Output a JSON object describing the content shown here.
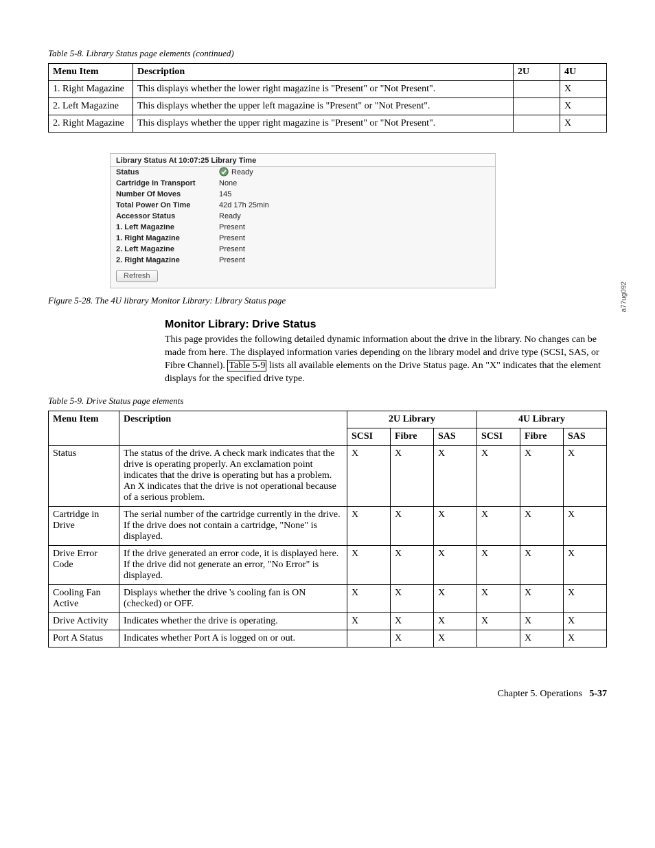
{
  "caption1": "Table 5-8. Library Status page elements  (continued)",
  "table1": {
    "headers": [
      "Menu Item",
      "Description",
      "2U",
      "4U"
    ],
    "rows": [
      {
        "menu": "1. Right Magazine",
        "desc": "This displays whether the lower right magazine is \"Present\" or \"Not Present\".",
        "c2u": "",
        "c4u": "X"
      },
      {
        "menu": "2. Left Magazine",
        "desc": "This displays whether the upper left magazine is \"Present\" or \"Not Present\".",
        "c2u": "",
        "c4u": "X"
      },
      {
        "menu": "2. Right Magazine",
        "desc": "This displays whether the upper right magazine is \"Present\" or \"Not Present\".",
        "c2u": "",
        "c4u": "X"
      }
    ]
  },
  "shot": {
    "title": "Library Status At 10:07:25 Library Time",
    "rows": [
      {
        "label": "Status",
        "value": "Ready",
        "icon": true
      },
      {
        "label": "Cartridge In Transport",
        "value": "None"
      },
      {
        "label": "Number Of Moves",
        "value": "145"
      },
      {
        "label": "Total Power On Time",
        "value": "42d 17h 25min"
      },
      {
        "label": "Accessor Status",
        "value": "Ready"
      },
      {
        "label": "1. Left Magazine",
        "value": "Present"
      },
      {
        "label": "1. Right Magazine",
        "value": "Present"
      },
      {
        "label": "2. Left Magazine",
        "value": "Present"
      },
      {
        "label": "2. Right Magazine",
        "value": "Present"
      }
    ],
    "button": "Refresh",
    "sidecode": "a77ug092"
  },
  "figcaption": "Figure 5-28. The 4U library Monitor Library: Library Status page",
  "heading": "Monitor Library: Drive Status",
  "paragraph_parts": {
    "p1": "This page provides the following detailed dynamic information about the drive in the library. No changes can be made from here. The displayed information varies depending on the library model and drive type (SCSI, SAS, or Fibre Channel). ",
    "link": "Table 5-9",
    "p2": " lists all available elements on the Drive Status page. An \"X\" indicates that the element displays for the specified drive type."
  },
  "caption2": "Table 5-9. Drive Status page elements",
  "table2": {
    "top_headers": {
      "menu": "Menu Item",
      "desc": "Description",
      "lib2u": "2U Library",
      "lib4u": "4U Library"
    },
    "sub_headers": [
      "SCSI",
      "Fibre",
      "SAS",
      "SCSI",
      "Fibre",
      "SAS"
    ],
    "rows": [
      {
        "menu": "Status",
        "desc": "The status of the drive. A check mark indicates that the drive is operating properly. An exclamation point indicates that the drive is operating but has a problem. An X indicates that the drive is not operational because of a serious problem.",
        "v": [
          "X",
          "X",
          "X",
          "X",
          "X",
          "X"
        ]
      },
      {
        "menu": "Cartridge in Drive",
        "desc": "The serial number of the cartridge currently in the drive. If the drive does not contain a cartridge, \"None\" is displayed.",
        "v": [
          "X",
          "X",
          "X",
          "X",
          "X",
          "X"
        ]
      },
      {
        "menu": "Drive Error Code",
        "desc": "If the drive generated an error code, it is displayed here. If the drive did not generate an error, \"No Error\" is displayed.",
        "v": [
          "X",
          "X",
          "X",
          "X",
          "X",
          "X"
        ]
      },
      {
        "menu": "Cooling Fan Active",
        "desc": "Displays whether the drive 's cooling fan is ON (checked) or OFF.",
        "v": [
          "X",
          "X",
          "X",
          "X",
          "X",
          "X"
        ]
      },
      {
        "menu": "Drive Activity",
        "desc": "Indicates whether the drive is operating.",
        "v": [
          "X",
          "X",
          "X",
          "X",
          "X",
          "X"
        ]
      },
      {
        "menu": "Port A Status",
        "desc": "Indicates whether Port A is logged on or out.",
        "v": [
          "",
          "X",
          "X",
          "",
          "X",
          "X"
        ]
      }
    ]
  },
  "footer": {
    "chapter": "Chapter 5. Operations",
    "page": "5-37"
  }
}
